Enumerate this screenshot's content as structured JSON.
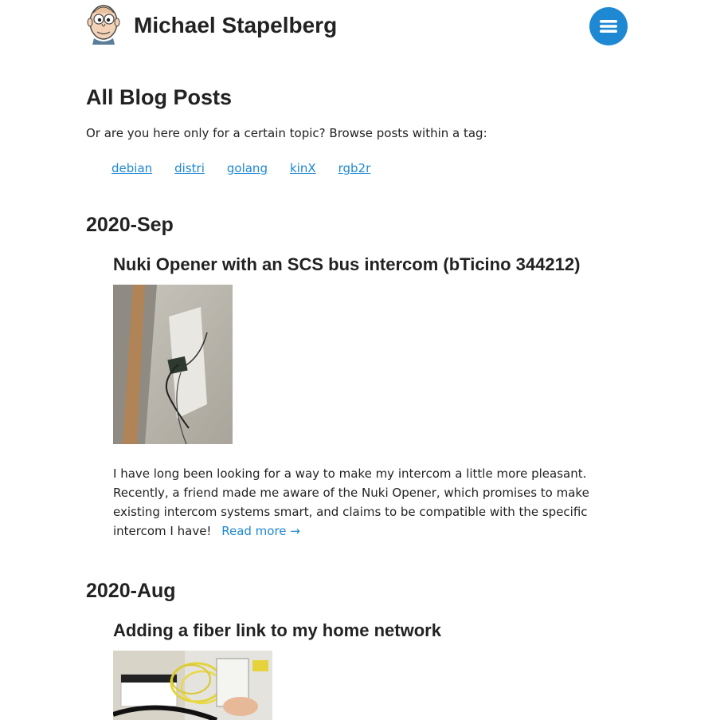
{
  "header": {
    "site_title": "Michael Stapelberg",
    "menu_icon": "hamburger-menu-icon",
    "accent_color": "#1e88d3"
  },
  "main": {
    "heading": "All Blog Posts",
    "intro": "Or are you here only for a certain topic? Browse posts within a tag:",
    "tags": [
      "debian",
      "distri",
      "golang",
      "kinX",
      "rgb2r"
    ],
    "months": [
      {
        "label": "2020-Sep",
        "posts": [
          {
            "title": "Nuki Opener with an SCS bus intercom (bTicino 344212)",
            "summary": "I have long been looking for a way to make my intercom a little more pleasant. Recently, a friend made me aware of the Nuki Opener, which promises to make existing intercom systems smart, and claims to be compatible with the specific intercom I have!",
            "read_more": "Read more →"
          }
        ]
      },
      {
        "label": "2020-Aug",
        "posts": [
          {
            "title": "Adding a fiber link to my home network"
          }
        ]
      }
    ]
  }
}
